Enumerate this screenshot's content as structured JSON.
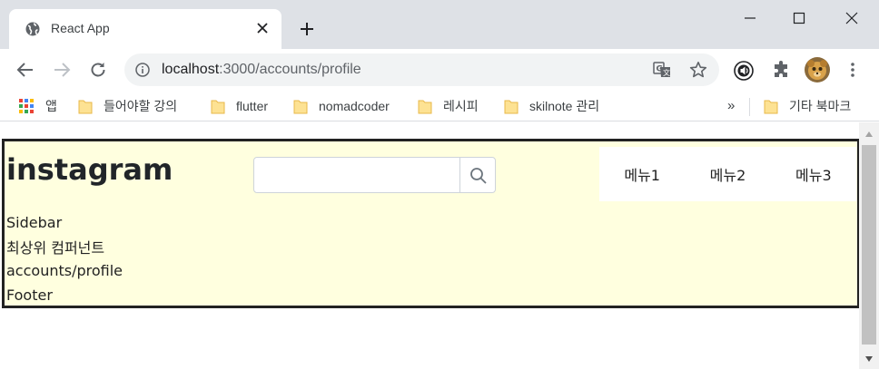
{
  "browser": {
    "tab_title": "React App",
    "url_host": "localhost",
    "url_rest": ":3000/accounts/profile"
  },
  "bookmarks": {
    "items": [
      {
        "label": "앱"
      },
      {
        "label": "들어야할 강의"
      },
      {
        "label": "flutter"
      },
      {
        "label": "nomadcoder"
      },
      {
        "label": "레시피"
      },
      {
        "label": "skilnote 관리"
      }
    ],
    "overflow": "»",
    "other": "기타 북마크"
  },
  "page": {
    "logo": "instagram",
    "search": {
      "value": "",
      "placeholder": ""
    },
    "menu": [
      "메뉴1",
      "메뉴2",
      "메뉴3"
    ],
    "sidebar": "Sidebar",
    "top_component": "최상위 컴퍼넌트",
    "route": "accounts/profile",
    "footer": "Footer"
  },
  "colors": {
    "app_background": "#ffffdf",
    "app_border": "#222222",
    "tabstrip": "#dee1e6",
    "omnibox": "#f1f3f4"
  }
}
